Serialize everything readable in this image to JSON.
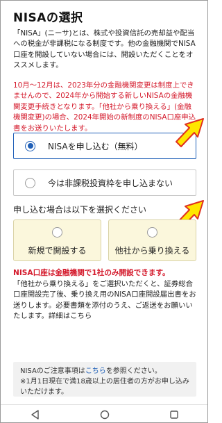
{
  "page": {
    "title": "NISAの選択"
  },
  "intro": {
    "text": "「NISA」(ニーサ)とは、株式や投資信託の売却益や配当への税金が非課税になる制度です。他の金融機関でNISA口座を開設していない場合には、開設いただくことをオススメします。"
  },
  "notice": {
    "text": "10月～12月は、2023年分の金融機関変更は制度上できませんので、2024年から開始する新しいNISAの金融機関変更手続きとなります。「他社から乗り換える」(金融機関変更)の場合、2024年開始の新制度のNISA口座申込書をお送りいたします。"
  },
  "options": {
    "apply": {
      "label": "NISAを申し込む（無料）",
      "selected": true
    },
    "skip": {
      "label": "今は非課税投資枠を申し込まない",
      "selected": false
    }
  },
  "apply_section": {
    "label": "申し込む場合は以下を選択ください",
    "new_open": "新規で開設する",
    "transfer": "他社から乗り換える"
  },
  "warning": {
    "bold": "NISA口座は金融機関で1社のみ開設できます。",
    "text": "「他社から乗り換える」をご選択いただくと、証券総合口座開設完了後、乗り換え用のNISA口座開設届出書をお送りします。必要書類を添付のうえ、ご返送をお願いいたします。詳細はこちら"
  },
  "note": {
    "prefix": "NISAのご注意事項は",
    "link": "こちら",
    "suffix": "を参照ください。",
    "line2": "※1月1日現在で満18歳以上の居住者の方がお申し込みいただけます。"
  },
  "colors": {
    "accent": "#1f5fb7",
    "warning": "#d4192b",
    "arrow_fill": "#ffe600",
    "arrow_stroke": "#e0301e",
    "card_bg": "#fbf7dc"
  }
}
